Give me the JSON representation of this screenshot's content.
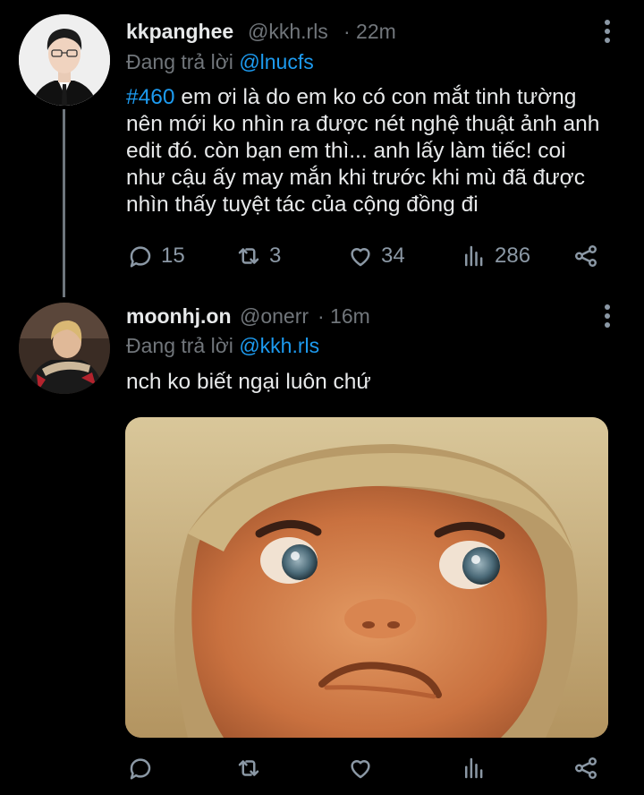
{
  "tweets": [
    {
      "name": "kkpanghee",
      "handle": "@kkh.rls",
      "time": "· 22m",
      "reply_prefix": "Đang trả lời",
      "reply_to": "@lnucfs",
      "hashtag": "#460",
      "line1_rest": " em ơi là do em ko có con mắt tinh tường",
      "line2": "nên mới ko nhìn ra được nét nghệ thuật ảnh anh",
      "line3": "edit đó. còn bạn em thì... anh lấy làm tiếc! coi",
      "line4": "như cậu ấy may mắn khi trước khi mù đã được",
      "line5": "nhìn thấy tuyệt tác của cộng đồng đi",
      "replies": "15",
      "retweets": "3",
      "likes": "34",
      "views": "286"
    },
    {
      "name": "moonhj.on",
      "handle": "@onerr",
      "time": "· 16m",
      "reply_prefix": "Đang trả lời",
      "reply_to": "@kkh.rls",
      "text": "nch ko biết ngại luôn chứ"
    }
  ],
  "icons": {
    "reply": "speech-bubble-icon",
    "retweet": "retweet-icon",
    "like": "heart-icon",
    "views": "bar-chart-icon",
    "share": "share-icon",
    "more": "vertical-dots-icon"
  },
  "colors": {
    "background": "#000000",
    "accent": "#1d9bf0",
    "muted": "#71767b",
    "text": "#e7e9ea"
  }
}
